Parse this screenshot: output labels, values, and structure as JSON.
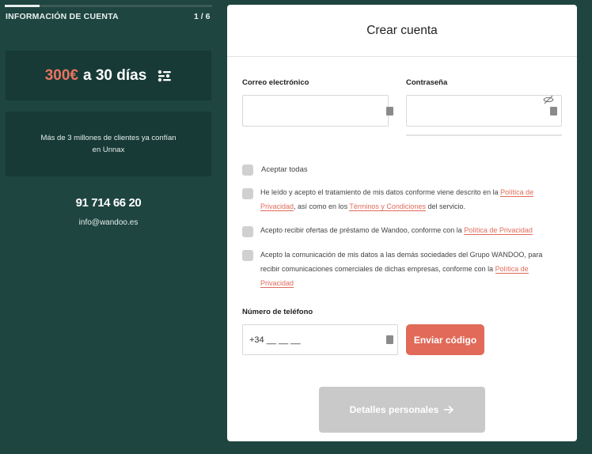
{
  "sidebar": {
    "progress_fraction": 0.167,
    "step_title": "INFORMACIÓN DE CUENTA",
    "step_counter": "1 / 6",
    "offer_amount": "300€",
    "offer_rest": "a 30 días",
    "offer_icon": "sliders-icon",
    "clients_text": "Más de 3 millones de clientes ya confían en Unnax",
    "phone": "91 714 66 20",
    "email": "info@wandoo.es"
  },
  "form": {
    "title": "Crear cuenta",
    "email_label": "Correo electrónico",
    "email_value": "",
    "password_label": "Contraseña",
    "password_value": "",
    "accept_all": "Aceptar todas",
    "consent1_pre": "He leído y acepto el tratamiento de mis datos conforme viene descrito en la ",
    "consent1_link1": "Política de Privacidad",
    "consent1_mid": ", así como en los ",
    "consent1_link2": "Términos y Condiciones",
    "consent1_post": " del servicio.",
    "consent2_pre": "Acepto recibir ofertas de préstamo de Wandoo, conforme con la ",
    "consent2_link": "Política de Privacidad",
    "consent3_pre": "Acepto la comunicación de mis datos a las demás sociedades del Grupo WANDOO, para recibir comunicaciones comerciales de dichas empresas, conforme con la ",
    "consent3_link": "Política de Privacidad",
    "phone_label": "Número de teléfono",
    "phone_value": "+34 __ __ __",
    "send_code_button": "Enviar código",
    "next_button": "Detalles personales",
    "next_icon": "arrow-right-icon"
  },
  "colors": {
    "background": "#1e4540",
    "card": "#173a36",
    "accent": "#e16a58",
    "disabled_button": "#c9c9c9"
  }
}
